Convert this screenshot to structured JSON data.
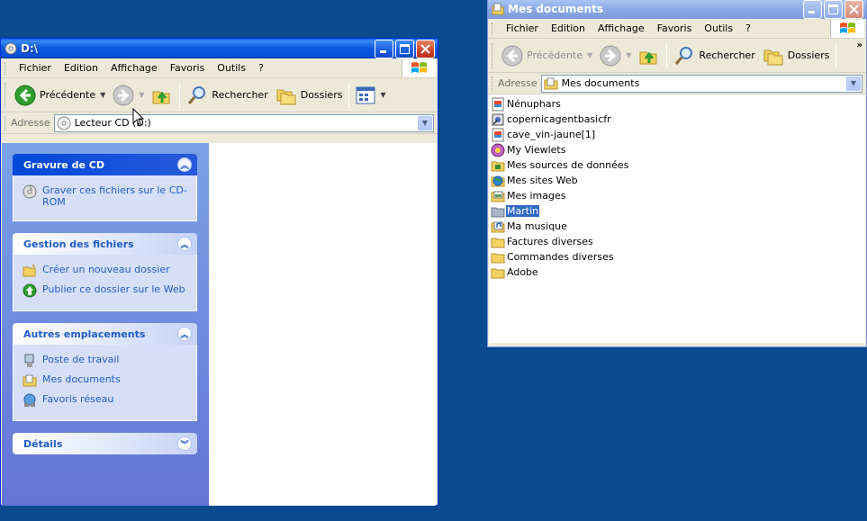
{
  "left_window": {
    "title": "D:\\",
    "menu": [
      "Fichier",
      "Edition",
      "Affichage",
      "Favoris",
      "Outils",
      "?"
    ],
    "toolbar": {
      "back_label": "Précédente",
      "search_label": "Rechercher",
      "folders_label": "Dossiers"
    },
    "address": {
      "label": "Adresse",
      "value": "Lecteur CD (D:)"
    },
    "task_panels": [
      {
        "title": "Gravure de CD",
        "tasks": [
          "Graver ces fichiers sur le CD-ROM"
        ]
      },
      {
        "title": "Gestion des fichiers",
        "tasks": [
          "Créer un nouveau dossier",
          "Publier ce dossier sur le Web"
        ]
      },
      {
        "title": "Autres emplacements",
        "tasks": [
          "Poste de travail",
          "Mes documents",
          "Favoris réseau"
        ]
      },
      {
        "title": "Détails",
        "tasks": []
      }
    ]
  },
  "right_window": {
    "title": "Mes documents",
    "menu": [
      "Fichier",
      "Edition",
      "Affichage",
      "Favoris",
      "Outils",
      "?"
    ],
    "toolbar": {
      "back_label": "Précédente",
      "search_label": "Rechercher",
      "folders_label": "Dossiers",
      "more": "»"
    },
    "address": {
      "label": "Adresse",
      "value": "Mes documents"
    },
    "files": [
      {
        "name": "Nénuphars",
        "icon": "image-file"
      },
      {
        "name": "copernicagentbasicfr",
        "icon": "installer-file"
      },
      {
        "name": "cave_vin-jaune[1]",
        "icon": "image-file"
      },
      {
        "name": "My Viewlets",
        "icon": "special-folder"
      },
      {
        "name": "Mes sources de données",
        "icon": "data-folder"
      },
      {
        "name": "Mes sites Web",
        "icon": "web-folder"
      },
      {
        "name": "Mes images",
        "icon": "pictures-folder"
      },
      {
        "name": "Martin",
        "icon": "shared-folder",
        "selected": true
      },
      {
        "name": "Ma musique",
        "icon": "music-folder"
      },
      {
        "name": "Factures diverses",
        "icon": "folder"
      },
      {
        "name": "Commandes diverses",
        "icon": "folder"
      },
      {
        "name": "Adobe",
        "icon": "folder"
      }
    ]
  },
  "colors": {
    "desktop": "#0a4a8e",
    "title_active": "#0a5ae0",
    "link": "#215dc6",
    "selection": "#316ac5"
  }
}
